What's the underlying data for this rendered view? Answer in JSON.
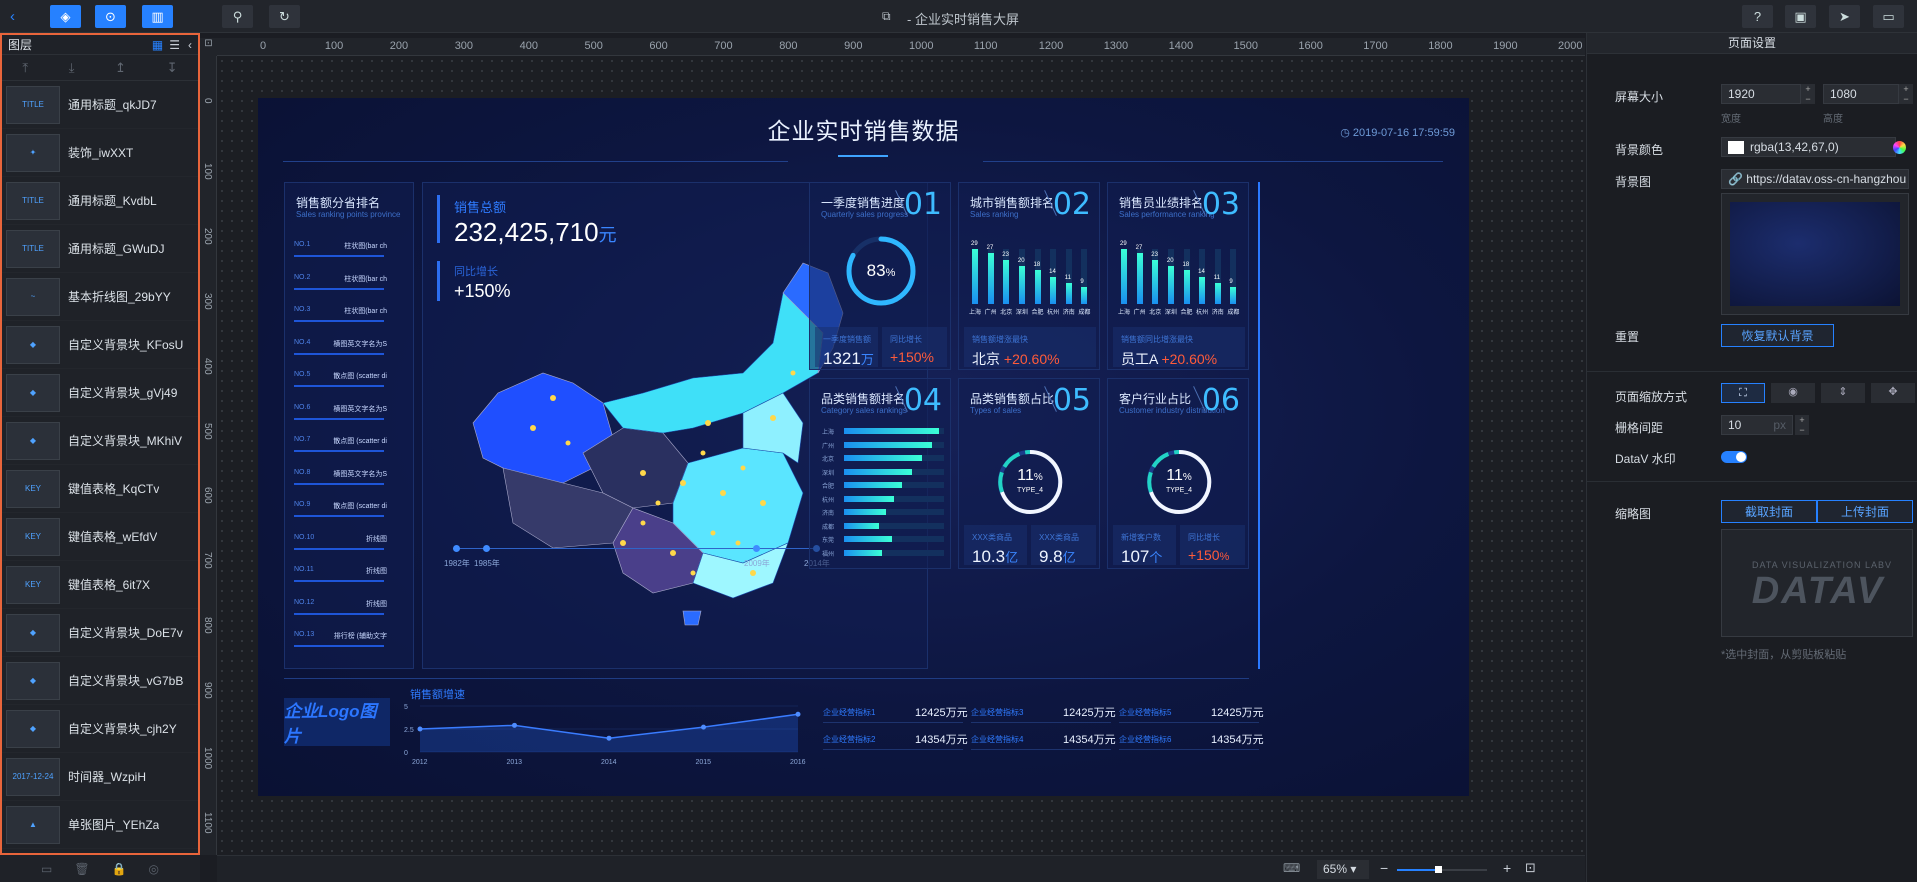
{
  "topbar": {
    "title": "- 企业实时销售大屏"
  },
  "layers": {
    "header": "图层",
    "items": [
      {
        "thumb": "TITLE",
        "name": "通用标题_qkJD7"
      },
      {
        "thumb": "✦",
        "name": "装饰_iwXXT"
      },
      {
        "thumb": "TITLE",
        "name": "通用标题_KvdbL"
      },
      {
        "thumb": "TITLE",
        "name": "通用标题_GWuDJ"
      },
      {
        "thumb": "~",
        "name": "基本折线图_29bYY"
      },
      {
        "thumb": "◆",
        "name": "自定义背景块_KFosU"
      },
      {
        "thumb": "◆",
        "name": "自定义背景块_gVj49"
      },
      {
        "thumb": "◆",
        "name": "自定义背景块_MKhiV"
      },
      {
        "thumb": "KEY",
        "name": "键值表格_KqCTv"
      },
      {
        "thumb": "KEY",
        "name": "键值表格_wEfdV"
      },
      {
        "thumb": "KEY",
        "name": "键值表格_6it7X"
      },
      {
        "thumb": "◆",
        "name": "自定义背景块_DoE7v"
      },
      {
        "thumb": "◆",
        "name": "自定义背景块_vG7bB"
      },
      {
        "thumb": "◆",
        "name": "自定义背景块_cjh2Y"
      },
      {
        "thumb": "2017-12-24",
        "name": "时间器_WzpiH"
      },
      {
        "thumb": "▲",
        "name": "单张图片_YEhZa"
      }
    ]
  },
  "ruler": {
    "top": [
      "0",
      "100",
      "200",
      "300",
      "400",
      "500",
      "600",
      "700",
      "800",
      "900",
      "1000",
      "1100",
      "1200",
      "1300",
      "1400",
      "1500",
      "1600",
      "1700",
      "1800",
      "1900",
      "2000"
    ],
    "left": [
      "0",
      "100",
      "200",
      "300",
      "400",
      "500",
      "600",
      "700",
      "800",
      "900",
      "1000",
      "1100"
    ]
  },
  "screen": {
    "title": "企业实时销售数据",
    "time": "2019-07-16 17:59:59",
    "rank": {
      "title": "销售额分省排名",
      "sub": "Sales ranking points province",
      "rows": [
        {
          "no": "NO.1",
          "label": "柱状图(bar ch"
        },
        {
          "no": "NO.2",
          "label": "柱状图(bar ch"
        },
        {
          "no": "NO.3",
          "label": "柱状图(bar ch"
        },
        {
          "no": "NO.4",
          "label": "横图英文字名为S"
        },
        {
          "no": "NO.5",
          "label": "散点图 (scatter di"
        },
        {
          "no": "NO.6",
          "label": "横图英文字名为S"
        },
        {
          "no": "NO.7",
          "label": "散点图 (scatter di"
        },
        {
          "no": "NO.8",
          "label": "横图英文字名为S"
        },
        {
          "no": "NO.9",
          "label": "散点图 (scatter di"
        },
        {
          "no": "NO.10",
          "label": "折线图"
        },
        {
          "no": "NO.11",
          "label": "折线图"
        },
        {
          "no": "NO.12",
          "label": "折线图"
        },
        {
          "no": "NO.13",
          "label": "排行榜 (辅助文字"
        }
      ]
    },
    "total": {
      "label": "销售总额",
      "value": "232,425,710",
      "unit": "元",
      "growth_label": "同比增长",
      "growth": "+150%"
    },
    "map": {
      "timeline": [
        "1982年",
        "1985年",
        "2009年",
        "2014年"
      ]
    },
    "p01": {
      "title": "一季度销售进度",
      "sub": "Quarterly sales progress",
      "num": "01",
      "pct": "83",
      "pct_unit": "%",
      "k1": "一季度销售额",
      "v1": "1321",
      "v1u": "万",
      "k2": "同比增长",
      "v2": "+150%"
    },
    "p02": {
      "title": "城市销售额排名",
      "sub": "Sales ranking",
      "num": "02",
      "k1": "销售额增涨最快",
      "v1": "北京",
      "v1b": "+20.60%"
    },
    "p03": {
      "title": "销售员业绩排名",
      "sub": "Sales performance ranking",
      "num": "03",
      "k1": "销售额同比增涨最快",
      "v1": "员工A",
      "v1b": "+20.60%"
    },
    "p04": {
      "title": "品类销售额排名",
      "sub": "Category sales rankings",
      "num": "04"
    },
    "p05": {
      "title": "品类销售额占比",
      "sub": "Types of sales",
      "num": "05",
      "pct": "11",
      "pct_unit": "%",
      "type": "TYPE_4",
      "k1": "XXX类商品",
      "v1": "10.3",
      "v1u": "亿",
      "k2": "XXX类商品",
      "v2": "9.8",
      "v2u": "亿"
    },
    "p06": {
      "title": "客户行业占比",
      "sub": "Customer industry distribution",
      "num": "06",
      "pct": "11",
      "pct_unit": "%",
      "type": "TYPE_4",
      "k1": "新增客户数",
      "v1": "107",
      "v1u": "个",
      "k2": "同比增长",
      "v2": "+150",
      "v2u": "%"
    },
    "logo": "企业Logo图片",
    "line_title": "销售额增速",
    "table": [
      {
        "k": "企业经营指标1",
        "v": "12425万元"
      },
      {
        "k": "企业经营指标2",
        "v": "14354万元"
      },
      {
        "k": "企业经营指标3",
        "v": "12425万元"
      },
      {
        "k": "企业经营指标4",
        "v": "14354万元"
      },
      {
        "k": "企业经营指标5",
        "v": "12425万元"
      },
      {
        "k": "企业经营指标6",
        "v": "14354万元"
      }
    ]
  },
  "city_bars": {
    "values": [
      29,
      27,
      23,
      20,
      18,
      14,
      11,
      9
    ],
    "labels": [
      "上海",
      "广州",
      "北京",
      "深圳",
      "合肥",
      "杭州",
      "济南",
      "成都"
    ]
  },
  "perf_bars": {
    "values": [
      29,
      27,
      23,
      20,
      18,
      14,
      11,
      9
    ],
    "labels": [
      "上海",
      "广州",
      "北京",
      "深圳",
      "合肥",
      "杭州",
      "济南",
      "成都"
    ]
  },
  "cat_bars": {
    "labels": [
      "上海",
      "广州",
      "北京",
      "深圳",
      "合肥",
      "杭州",
      "济南",
      "成都",
      "东莞",
      "福州"
    ],
    "values": [
      0.95,
      0.88,
      0.78,
      0.68,
      0.58,
      0.5,
      0.42,
      0.35,
      0.48,
      0.38
    ]
  },
  "line_chart": {
    "x": [
      "2012",
      "2013",
      "2014",
      "2015",
      "2016"
    ],
    "y": [
      2.5,
      2.9,
      1.5,
      2.7,
      4.1
    ],
    "yticks": [
      "0",
      "2.5",
      "5"
    ]
  },
  "settings": {
    "header": "页面设置",
    "screen_size": "屏幕大小",
    "width": "1920",
    "height": "1080",
    "width_lbl": "宽度",
    "height_lbl": "高度",
    "bg_color": "背景颜色",
    "bg_color_val": "rgba(13,42,67,0)",
    "bg_image": "背景图",
    "bg_image_val": "https://datav.oss-cn-hangzhou",
    "reset": "重置",
    "reset_btn": "恢复默认背景",
    "scale": "页面缩放方式",
    "grid": "栅格间距",
    "grid_val": "10",
    "grid_unit": "px",
    "watermark": "DataV 水印",
    "thumb": "缩略图",
    "thumb_btn1": "截取封面",
    "thumb_btn2": "上传封面",
    "thumb_hint": "*选中封面，从剪贴板粘贴",
    "thumb_logo_top": "DATA VISUALIZATION LABV",
    "thumb_logo": "DATAV"
  },
  "bottom": {
    "zoom": "65%"
  }
}
